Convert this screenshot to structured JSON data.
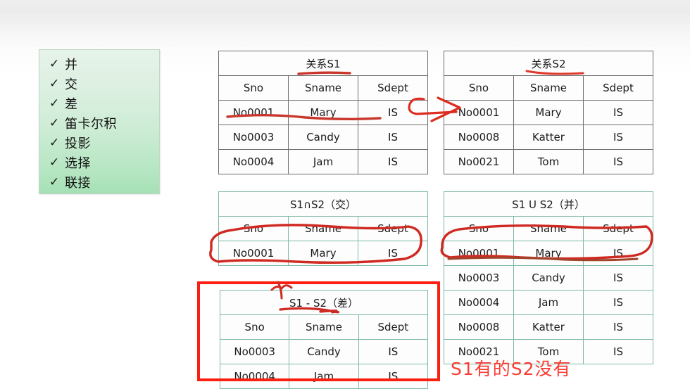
{
  "checklist": {
    "check_glyph": "✓",
    "items": [
      {
        "label": "并"
      },
      {
        "label": "交"
      },
      {
        "label": "差"
      },
      {
        "label": "笛卡尔积"
      },
      {
        "label": "投影"
      },
      {
        "label": "选择"
      },
      {
        "label": "联接"
      }
    ]
  },
  "colors": {
    "annotation_red": "#cf2a22",
    "highlight_red": "#fa1f11",
    "caption_red": "#fb3b33",
    "table_border_grey": "#6e6e6e",
    "table_border_teal": "#7fb8a8",
    "card_green_top": "#e6f3e9",
    "card_green_bottom": "#a6e0b5"
  },
  "tables": {
    "s1": {
      "title": "关系S1",
      "columns": [
        "Sno",
        "Sname",
        "Sdept"
      ],
      "rows": [
        [
          "No0001",
          "Mary",
          "IS"
        ],
        [
          "No0003",
          "Candy",
          "IS"
        ],
        [
          "No0004",
          "Jam",
          "IS"
        ]
      ]
    },
    "s2": {
      "title": "关系S2",
      "columns": [
        "Sno",
        "Sname",
        "Sdept"
      ],
      "rows": [
        [
          "No0001",
          "Mary",
          "IS"
        ],
        [
          "No0008",
          "Katter",
          "IS"
        ],
        [
          "No0021",
          "Tom",
          "IS"
        ]
      ]
    },
    "intersection": {
      "title": "S1∩S2（交）",
      "columns": [
        "Sno",
        "Sname",
        "Sdept"
      ],
      "rows": [
        [
          "No0001",
          "Mary",
          "IS"
        ]
      ]
    },
    "union": {
      "title": "S1 U S2（并）",
      "columns": [
        "Sno",
        "Sname",
        "Sdept"
      ],
      "rows": [
        [
          "No0001",
          "Mary",
          "IS"
        ],
        [
          "No0003",
          "Candy",
          "IS"
        ],
        [
          "No0004",
          "Jam",
          "IS"
        ],
        [
          "No0008",
          "Katter",
          "IS"
        ],
        [
          "No0021",
          "Tom",
          "IS"
        ]
      ]
    },
    "difference": {
      "title": "S1 - S2（差）",
      "columns": [
        "Sno",
        "Sname",
        "Sdept"
      ],
      "rows": [
        [
          "No0003",
          "Candy",
          "IS"
        ],
        [
          "No0004",
          "Jam",
          "IS"
        ]
      ]
    }
  },
  "annotations": {
    "caption": "S1有的S2没有"
  }
}
